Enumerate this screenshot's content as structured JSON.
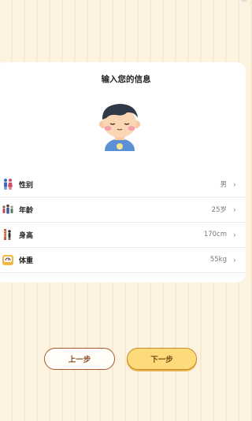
{
  "card": {
    "title": "输入您的信息"
  },
  "rows": [
    {
      "label": "性别",
      "value": "男",
      "icon": "gender-icon"
    },
    {
      "label": "年龄",
      "value": "25岁",
      "icon": "age-icon"
    },
    {
      "label": "身高",
      "value": "170cm",
      "icon": "height-icon"
    },
    {
      "label": "体重",
      "value": "55kg",
      "icon": "weight-icon"
    }
  ],
  "buttons": {
    "prev_label": "上一步",
    "next_label": "下一步"
  },
  "colors": {
    "background": "#fcf3e1",
    "next_button": "#fddb7b",
    "prev_border": "#a8582c"
  }
}
